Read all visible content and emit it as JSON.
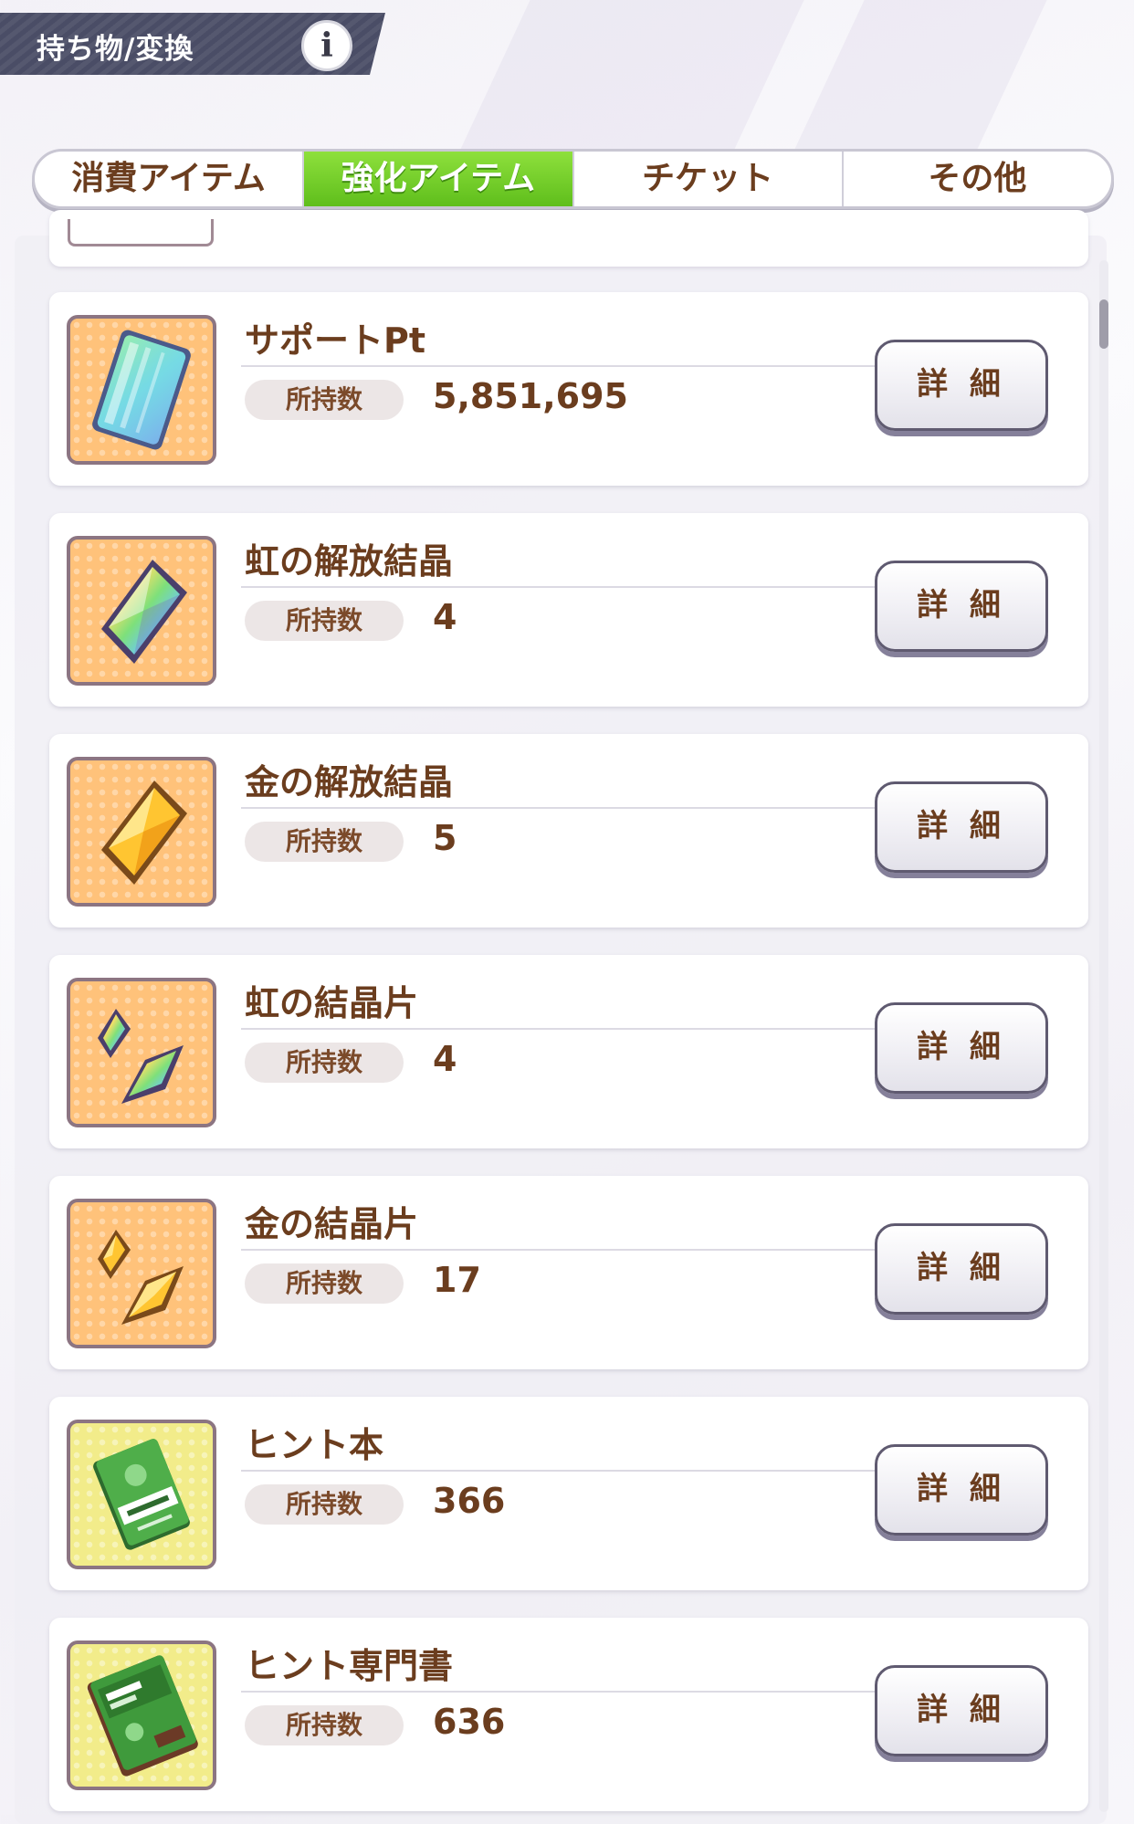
{
  "header": {
    "title": "持ち物/変換",
    "info_label": "i"
  },
  "tabs": [
    {
      "label": "消費アイテム",
      "active": false
    },
    {
      "label": "強化アイテム",
      "active": true
    },
    {
      "label": "チケット",
      "active": false
    },
    {
      "label": "その他",
      "active": false
    }
  ],
  "items": [
    {
      "name": "サポートPt",
      "owned_label": "所持数",
      "count": "5,851,695",
      "detail_label": "詳 細",
      "icon": "support-pt-card-icon"
    },
    {
      "name": "虹の解放結晶",
      "owned_label": "所持数",
      "count": "4",
      "detail_label": "詳 細",
      "icon": "rainbow-crystal-icon"
    },
    {
      "name": "金の解放結晶",
      "owned_label": "所持数",
      "count": "5",
      "detail_label": "詳 細",
      "icon": "gold-crystal-icon"
    },
    {
      "name": "虹の結晶片",
      "owned_label": "所持数",
      "count": "4",
      "detail_label": "詳 細",
      "icon": "rainbow-shards-icon"
    },
    {
      "name": "金の結晶片",
      "owned_label": "所持数",
      "count": "17",
      "detail_label": "詳 細",
      "icon": "gold-shards-icon"
    },
    {
      "name": "ヒント本",
      "owned_label": "所持数",
      "count": "366",
      "detail_label": "詳 細",
      "icon": "hint-book-icon"
    },
    {
      "name": "ヒント専門書",
      "owned_label": "所持数",
      "count": "636",
      "detail_label": "詳 細",
      "icon": "hint-specialty-book-icon"
    }
  ],
  "colors": {
    "active_tab": "#6cc924",
    "text_brown": "#6b3d1e",
    "header_bg": "#4a4d66"
  }
}
